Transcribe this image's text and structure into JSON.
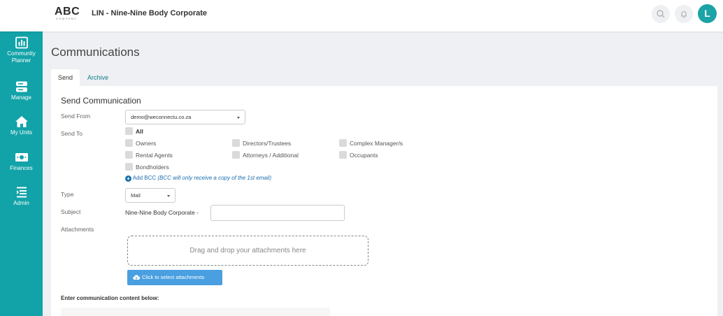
{
  "header": {
    "logo_text": "ABC",
    "logo_sub": "COMPANY",
    "title": "LIN - Nine-Nine Body Corporate",
    "avatar_letter": "L",
    "accent": "#12a3a8"
  },
  "sidebar": {
    "items": [
      {
        "label": "Community Planner",
        "line1": "Community",
        "line2": "Planner",
        "icon": "bar-chart-icon"
      },
      {
        "label": "Manage",
        "icon": "server-icon"
      },
      {
        "label": "My Units",
        "icon": "home-icon"
      },
      {
        "label": "Finances",
        "icon": "money-icon"
      },
      {
        "label": "Admin",
        "icon": "list-icon"
      }
    ]
  },
  "page": {
    "title": "Communications",
    "tabs": [
      {
        "label": "Send",
        "active": true
      },
      {
        "label": "Archive",
        "active": false
      }
    ]
  },
  "form": {
    "section_title": "Send Communication",
    "send_from_label": "Send From",
    "send_from_value": "demo@weconnectu.co.za",
    "send_to_label": "Send To",
    "recipients": {
      "all": "All",
      "owners": "Owners",
      "directors": "Directors/Trustees",
      "complex_manager": "Complex Manager/s",
      "rental_agents": "Rental Agents",
      "attorneys": "Attorneys / Additional",
      "occupants": "Occupants",
      "bondholders": "Bondholders"
    },
    "add_bcc_label": "Add BCC",
    "add_bcc_note": "(BCC will only receive a copy of the 1st email)",
    "type_label": "Type",
    "type_value": "Mail",
    "subject_label": "Subject",
    "subject_prefix": "Nine-Nine Body Corporate -",
    "subject_value": "",
    "attachments_label": "Attachments",
    "dropzone_text": "Drag and drop your attachments here",
    "upload_button": "Click to select attachments",
    "content_label": "Enter communication content below:"
  }
}
